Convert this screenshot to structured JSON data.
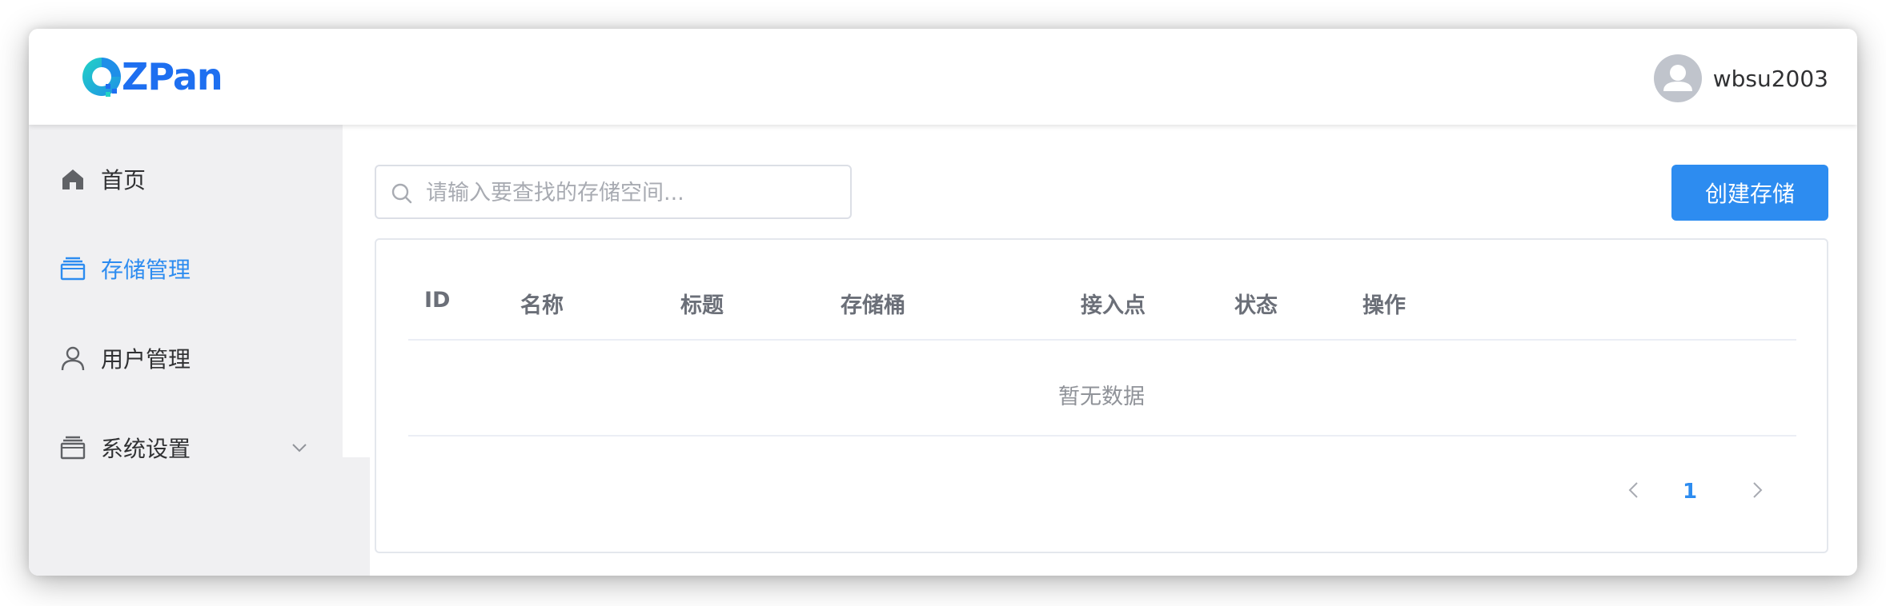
{
  "header": {
    "logo_text": "ZPan",
    "username": "wbsu2003"
  },
  "sidebar": {
    "items": [
      {
        "label": "首页",
        "icon": "home-icon",
        "active": false
      },
      {
        "label": "存储管理",
        "icon": "storage-icon",
        "active": true
      },
      {
        "label": "用户管理",
        "icon": "user-icon",
        "active": false
      },
      {
        "label": "系统设置",
        "icon": "settings-icon",
        "active": false,
        "has_submenu": true
      }
    ]
  },
  "search": {
    "placeholder": "请输入要查找的存储空间...",
    "value": ""
  },
  "toolbar": {
    "create_label": "创建存储"
  },
  "table": {
    "columns": [
      "ID",
      "名称",
      "标题",
      "存储桶",
      "接入点",
      "状态",
      "操作"
    ],
    "rows": [],
    "empty_text": "暂无数据"
  },
  "pagination": {
    "current_page": "1"
  },
  "colors": {
    "accent": "#2d8cf0",
    "logo_blue": "#1e6ff0",
    "logo_teal": "#1ec9c0",
    "sidebar_bg": "#f0f0f2"
  }
}
